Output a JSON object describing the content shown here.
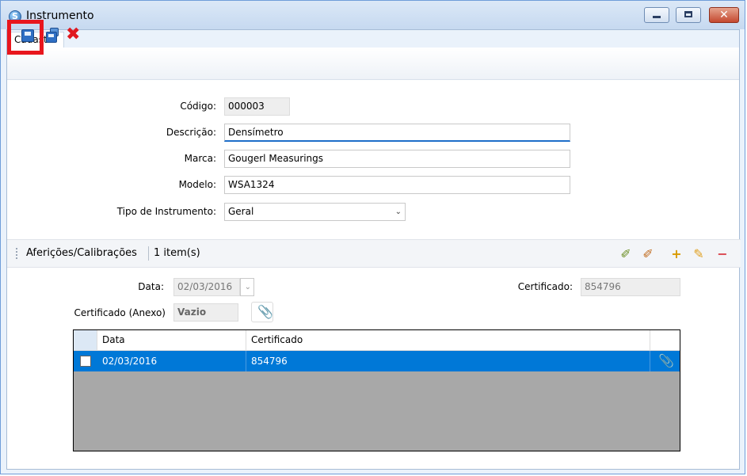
{
  "window": {
    "title": "Instrumento",
    "buttons": {
      "minimize": "–",
      "maximize": "□",
      "close": "✕"
    }
  },
  "tabs": [
    {
      "label": "Cadastro",
      "active": true
    }
  ],
  "toolbar": {
    "icons": [
      "save-icon",
      "save-as-icon",
      "delete-icon"
    ],
    "highlight_color": "#e8161d"
  },
  "form": {
    "codigo": {
      "label": "Código:",
      "value": "000003"
    },
    "descricao": {
      "label": "Descrição:",
      "value": "Densímetro"
    },
    "marca": {
      "label": "Marca:",
      "value": "Gougerl Measurings"
    },
    "modelo": {
      "label": "Modelo:",
      "value": "WSA1324"
    },
    "tipo": {
      "label": "Tipo de Instrumento:",
      "value": "Geral"
    }
  },
  "section": {
    "title": "Aferições/Calibrações",
    "count": "1 item(s)",
    "data_label": "Data:",
    "data_value": "02/03/2016",
    "certificado_label": "Certificado:",
    "certificado_value": "854796",
    "anexo_label": "Certificado (Anexo)",
    "anexo_value": "Vazio"
  },
  "grid": {
    "columns": [
      "Data",
      "Certificado"
    ],
    "rows": [
      {
        "data": "02/03/2016",
        "certificado": "854796",
        "selected": true
      }
    ],
    "selection_color": "#0078d7"
  },
  "colors": {
    "accent": "#1e6ec9",
    "delete": "#e0191f"
  }
}
